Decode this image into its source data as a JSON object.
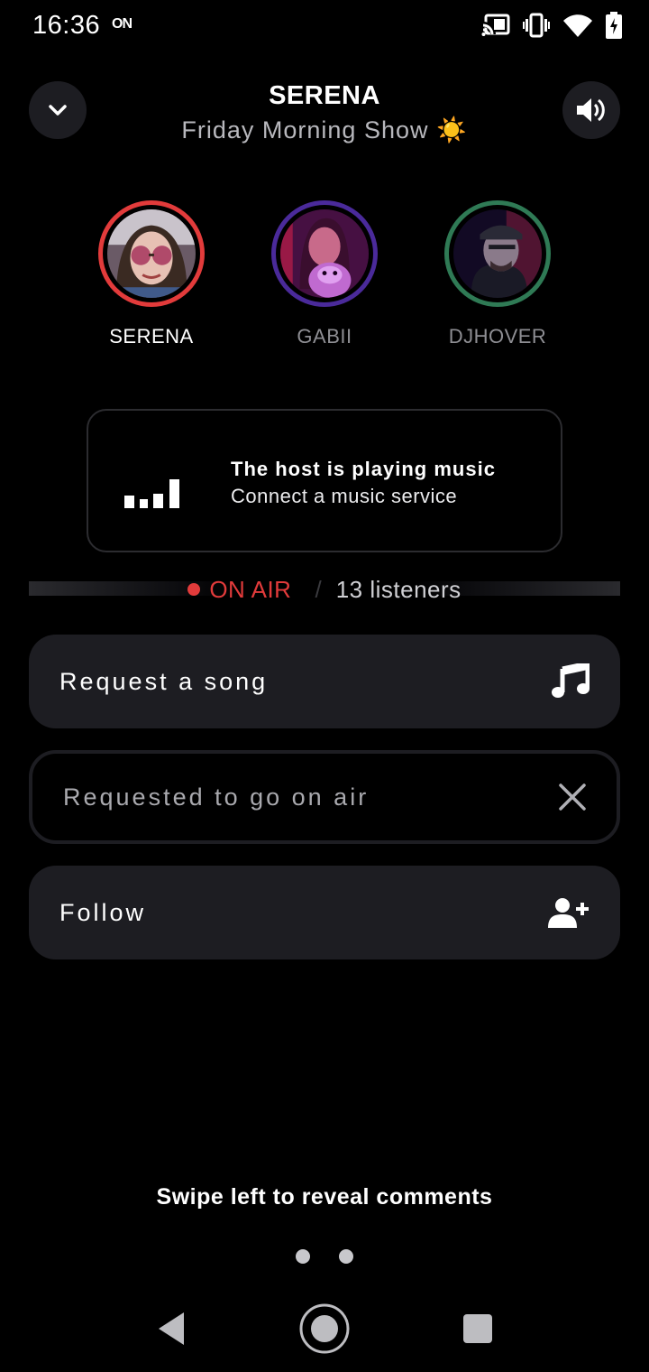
{
  "status_bar": {
    "time": "16:36",
    "on_badge": "ON",
    "icons": [
      "cast-icon",
      "vibrate-icon",
      "wifi-icon",
      "battery-charging-icon"
    ]
  },
  "header": {
    "collapse_icon": "chevron-down-icon",
    "volume_icon": "volume-icon",
    "host": "SERENA",
    "show_title": "Friday Morning Show ☀️"
  },
  "hosts": [
    {
      "name": "SERENA",
      "ring_color": "#e23b3b",
      "active": true
    },
    {
      "name": "GABII",
      "ring_color": "#4a2a9a",
      "active": false
    },
    {
      "name": "DJHOVER",
      "ring_color": "#2f7a55",
      "active": false
    }
  ],
  "music_card": {
    "icon": "signal-bars-icon",
    "title": "The host is playing music",
    "subtitle": "Connect a music service"
  },
  "live": {
    "status": "ON AIR",
    "separator": "/",
    "listeners": "13 listeners",
    "status_color": "#e23b3b"
  },
  "actions": [
    {
      "label": "Request a song",
      "icon": "music-note-icon"
    },
    {
      "label": "Requested to go on air",
      "icon": "close-icon"
    },
    {
      "label": "Follow",
      "icon": "add-user-icon"
    }
  ],
  "footer": {
    "hint": "Swipe left to reveal comments",
    "page_count": 2
  },
  "nav_bar": {
    "icons": [
      "back-icon",
      "home-icon",
      "recents-icon"
    ]
  }
}
